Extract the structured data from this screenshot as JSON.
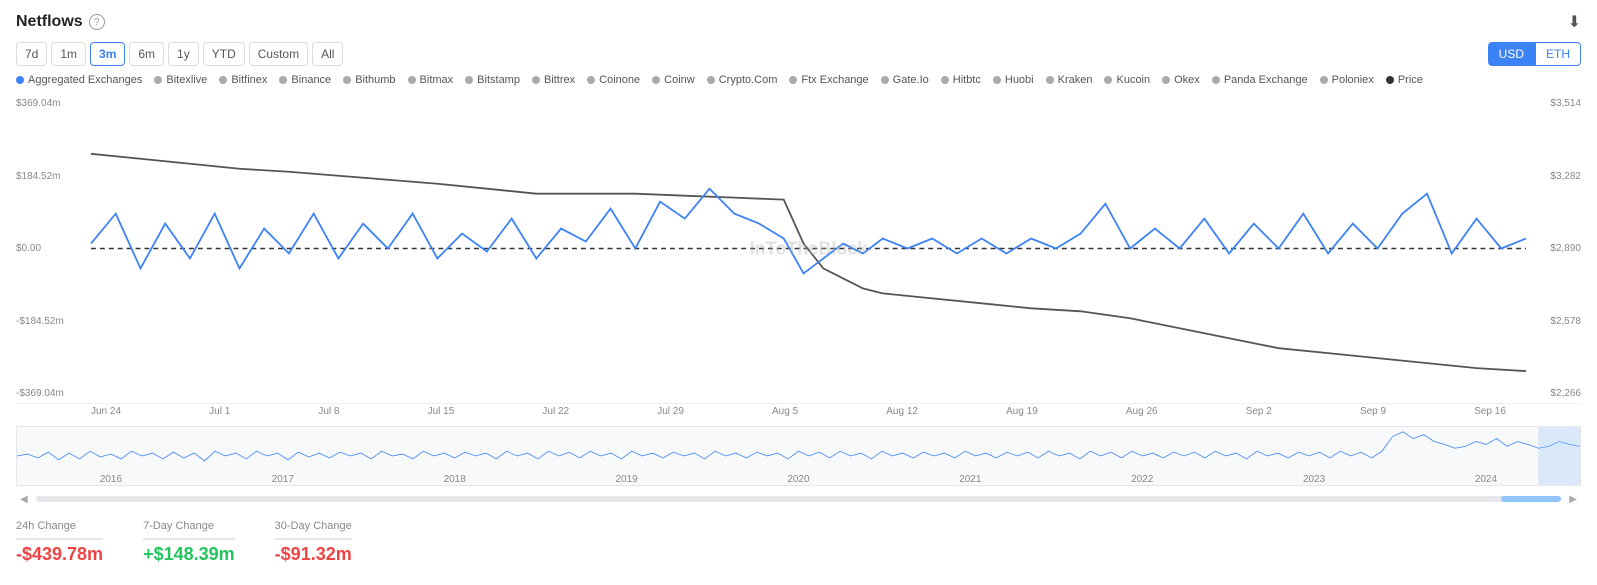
{
  "header": {
    "title": "Netflows",
    "help_tooltip": "?",
    "download_icon": "⬇"
  },
  "time_buttons": [
    {
      "label": "7d",
      "active": false
    },
    {
      "label": "1m",
      "active": false
    },
    {
      "label": "3m",
      "active": true
    },
    {
      "label": "6m",
      "active": false
    },
    {
      "label": "1y",
      "active": false
    },
    {
      "label": "YTD",
      "active": false
    },
    {
      "label": "Custom",
      "active": false
    },
    {
      "label": "All",
      "active": false
    }
  ],
  "currency_buttons": [
    {
      "label": "USD",
      "active": true
    },
    {
      "label": "ETH",
      "active": false
    }
  ],
  "legend": [
    {
      "label": "Aggregated Exchanges",
      "color": "blue"
    },
    {
      "label": "Bitexlive",
      "color": "gray"
    },
    {
      "label": "Bitfinex",
      "color": "gray"
    },
    {
      "label": "Binance",
      "color": "gray"
    },
    {
      "label": "Bithumb",
      "color": "gray"
    },
    {
      "label": "Bitmax",
      "color": "gray"
    },
    {
      "label": "Bitstamp",
      "color": "gray"
    },
    {
      "label": "Bittrex",
      "color": "gray"
    },
    {
      "label": "Coinone",
      "color": "gray"
    },
    {
      "label": "Coinw",
      "color": "gray"
    },
    {
      "label": "Crypto.Com",
      "color": "gray"
    },
    {
      "label": "Ftx Exchange",
      "color": "gray"
    },
    {
      "label": "Gate.Io",
      "color": "gray"
    },
    {
      "label": "Hitbtc",
      "color": "gray"
    },
    {
      "label": "Huobi",
      "color": "gray"
    },
    {
      "label": "Kraken",
      "color": "gray"
    },
    {
      "label": "Kucoin",
      "color": "gray"
    },
    {
      "label": "Okex",
      "color": "gray"
    },
    {
      "label": "Panda Exchange",
      "color": "gray"
    },
    {
      "label": "Poloniex",
      "color": "gray"
    },
    {
      "label": "Price",
      "color": "dark"
    }
  ],
  "y_axis": {
    "left": [
      "$369.04m",
      "$184.52m",
      "$0.00",
      "-$184.52m",
      "-$369.04m"
    ],
    "right": [
      "$3,514",
      "$3,282",
      "$2,890",
      "$2,578",
      "$2,266"
    ]
  },
  "x_axis": [
    "Jun 24",
    "Jul 1",
    "Jul 8",
    "Jul 15",
    "Jul 22",
    "Jul 29",
    "Aug 5",
    "Aug 12",
    "Aug 19",
    "Aug 26",
    "Sep 2",
    "Sep 9",
    "Sep 16"
  ],
  "mini_x_axis": [
    "2016",
    "2017",
    "2018",
    "2019",
    "2020",
    "2021",
    "2022",
    "2023",
    "2024"
  ],
  "watermark": "InToTheBlock",
  "stats": [
    {
      "label": "24h Change",
      "value": "-$439.78m",
      "type": "negative"
    },
    {
      "label": "7-Day Change",
      "value": "+$148.39m",
      "type": "positive"
    },
    {
      "label": "30-Day Change",
      "value": "-$91.32m",
      "type": "negative"
    }
  ]
}
